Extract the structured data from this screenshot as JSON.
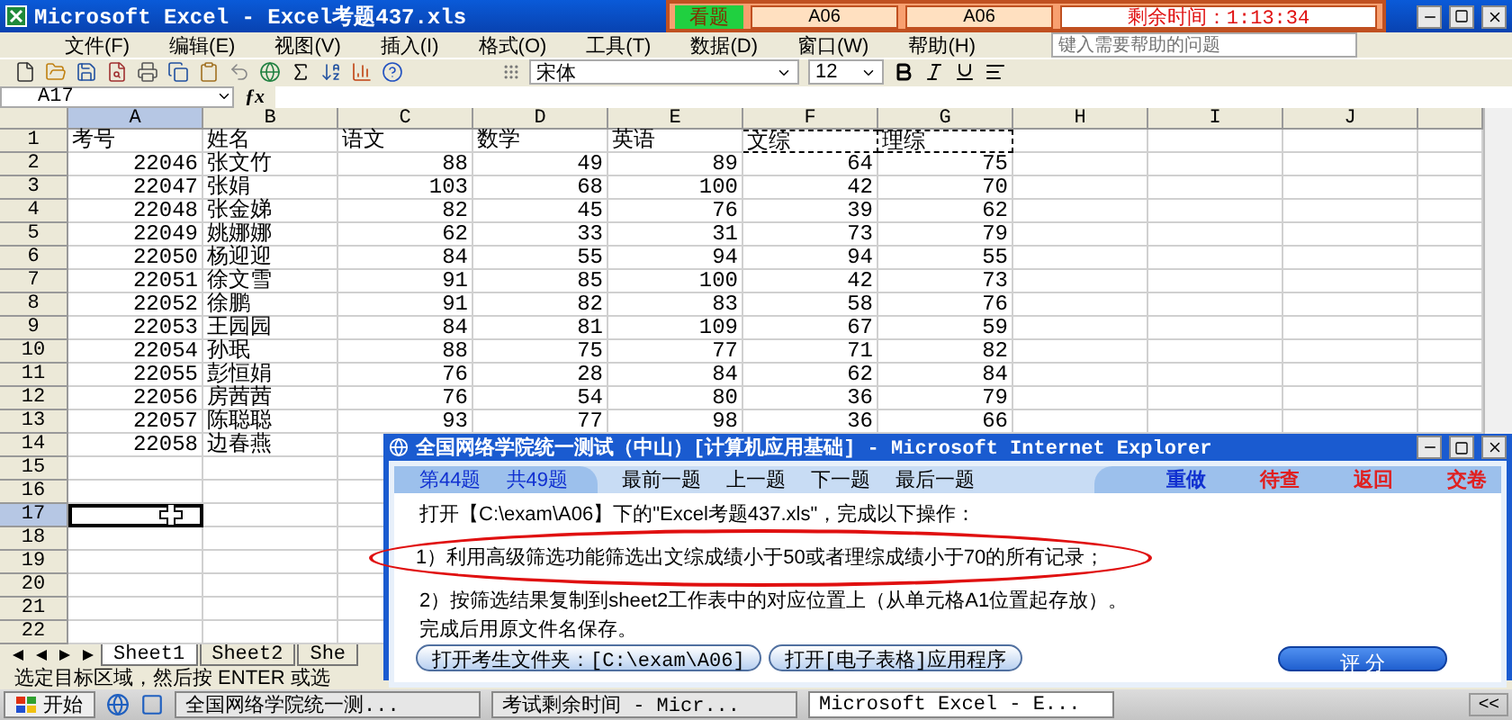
{
  "excel_window": {
    "title": "Microsoft Excel - Excel考题437.xls"
  },
  "exam_bar": {
    "view_button": "看题",
    "fields": [
      "A06",
      "A06"
    ],
    "timer": "剩余时间：1:13:34"
  },
  "menu": [
    "文件(F)",
    "编辑(E)",
    "视图(V)",
    "插入(I)",
    "格式(O)",
    "工具(T)",
    "数据(D)",
    "窗口(W)",
    "帮助(H)"
  ],
  "help_box": {
    "placeholder": "键入需要帮助的问题"
  },
  "toolbar": {
    "font": "宋体",
    "size": "12"
  },
  "formula_bar": {
    "name_box": "A17",
    "function_label": "ƒx"
  },
  "sheet": {
    "columns": [
      {
        "label": "A",
        "selected": true,
        "marquee": false
      },
      {
        "label": "B",
        "selected": false,
        "marquee": false
      },
      {
        "label": "C",
        "selected": false,
        "marquee": false
      },
      {
        "label": "D",
        "selected": false,
        "marquee": false
      },
      {
        "label": "E",
        "selected": false,
        "marquee": false
      },
      {
        "label": "F",
        "selected": false,
        "marquee": true
      },
      {
        "label": "G",
        "selected": false,
        "marquee": true
      },
      {
        "label": "H",
        "selected": false,
        "marquee": false
      },
      {
        "label": "I",
        "selected": false,
        "marquee": false
      },
      {
        "label": "J",
        "selected": false,
        "marquee": false
      }
    ],
    "rows": [
      {
        "number": "1",
        "selected": false,
        "marquee": true,
        "cells": [
          "考号",
          "姓名",
          "语文",
          "数学",
          "英语",
          "文综",
          "理综"
        ]
      },
      {
        "number": "2",
        "selected": false,
        "marquee": false,
        "cells": [
          "22046",
          "张文竹",
          "88",
          "49",
          "89",
          "64",
          "75"
        ]
      },
      {
        "number": "3",
        "selected": false,
        "marquee": false,
        "cells": [
          "22047",
          "张娟",
          "103",
          "68",
          "100",
          "42",
          "70"
        ]
      },
      {
        "number": "4",
        "selected": false,
        "marquee": false,
        "cells": [
          "22048",
          "张金娣",
          "82",
          "45",
          "76",
          "39",
          "62"
        ]
      },
      {
        "number": "5",
        "selected": false,
        "marquee": false,
        "cells": [
          "22049",
          "姚娜娜",
          "62",
          "33",
          "31",
          "73",
          "79"
        ]
      },
      {
        "number": "6",
        "selected": false,
        "marquee": false,
        "cells": [
          "22050",
          "杨迎迎",
          "84",
          "55",
          "94",
          "94",
          "55"
        ]
      },
      {
        "number": "7",
        "selected": false,
        "marquee": false,
        "cells": [
          "22051",
          "徐文雪",
          "91",
          "85",
          "100",
          "42",
          "73"
        ]
      },
      {
        "number": "8",
        "selected": false,
        "marquee": false,
        "cells": [
          "22052",
          "徐鹏",
          "91",
          "82",
          "83",
          "58",
          "76"
        ]
      },
      {
        "number": "9",
        "selected": false,
        "marquee": false,
        "cells": [
          "22053",
          "王园园",
          "84",
          "81",
          "109",
          "67",
          "59"
        ]
      },
      {
        "number": "10",
        "selected": false,
        "marquee": false,
        "cells": [
          "22054",
          "孙珉",
          "88",
          "75",
          "77",
          "71",
          "82"
        ]
      },
      {
        "number": "11",
        "selected": false,
        "marquee": false,
        "cells": [
          "22055",
          "彭恒娟",
          "76",
          "28",
          "84",
          "62",
          "84"
        ]
      },
      {
        "number": "12",
        "selected": false,
        "marquee": false,
        "cells": [
          "22056",
          "房茜茜",
          "76",
          "54",
          "80",
          "36",
          "79"
        ]
      },
      {
        "number": "13",
        "selected": false,
        "marquee": false,
        "cells": [
          "22057",
          "陈聪聪",
          "93",
          "77",
          "98",
          "36",
          "66"
        ]
      },
      {
        "number": "14",
        "selected": false,
        "marquee": false,
        "cells": [
          "22058",
          "边春燕"
        ]
      },
      {
        "number": "15",
        "selected": false,
        "marquee": false,
        "cells": []
      },
      {
        "number": "16",
        "selected": false,
        "marquee": false,
        "cells": []
      },
      {
        "number": "17",
        "selected": true,
        "marquee": false,
        "cells": []
      },
      {
        "number": "18",
        "selected": false,
        "marquee": false,
        "cells": []
      },
      {
        "number": "19",
        "selected": false,
        "marquee": false,
        "cells": []
      },
      {
        "number": "20",
        "selected": false,
        "marquee": false,
        "cells": []
      },
      {
        "number": "21",
        "selected": false,
        "marquee": false,
        "cells": []
      },
      {
        "number": "22",
        "selected": false,
        "marquee": false,
        "cells": []
      }
    ]
  },
  "sheet_tabs": [
    {
      "label": "Sheet1",
      "selected": true
    },
    {
      "label": "Sheet2",
      "selected": false
    },
    {
      "label": "She",
      "selected": false
    }
  ],
  "status_bar": "选定目标区域，然后按 ENTER 或选",
  "exam_dialog": {
    "title": "全国网络学院统一测试（中山）[计算机应用基础] - Microsoft Internet Explorer",
    "counter": [
      "第44题",
      "共49题"
    ],
    "navigation": [
      "最前一题",
      "上一题",
      "下一题",
      "最后一题"
    ],
    "actions": [
      {
        "label": "重做",
        "kind": "normal"
      },
      {
        "label": "待查",
        "kind": "alert"
      },
      {
        "label": "返回",
        "kind": "alert"
      },
      {
        "label": "交卷",
        "kind": "alert"
      }
    ],
    "instructions": [
      {
        "text": "打开【C:\\exam\\A06】下的\"Excel考题437.xls\"，完成以下操作：",
        "circled": false
      },
      {
        "text": "1）利用高级筛选功能筛选出文综成绩小于50或者理综成绩小于70的所有记录；",
        "circled": true
      },
      {
        "text": "2）按筛选结果复制到sheet2工作表中的对应位置上（从单元格A1位置起存放）。",
        "circled": false
      },
      {
        "text": "完成后用原文件名保存。",
        "circled": false
      }
    ],
    "buttons": [
      "打开考生文件夹：[C:\\exam\\A06]",
      "打开[电子表格]应用程序"
    ],
    "grade_button": "评 分"
  },
  "taskbar": {
    "start": "开始",
    "tasks": [
      {
        "label": "全国网络学院统一测...",
        "selected": false
      },
      {
        "label": "考试剩余时间 - Micr...",
        "selected": false
      },
      {
        "label": "Microsoft Excel - E...",
        "selected": true
      }
    ],
    "tray": "<<"
  }
}
